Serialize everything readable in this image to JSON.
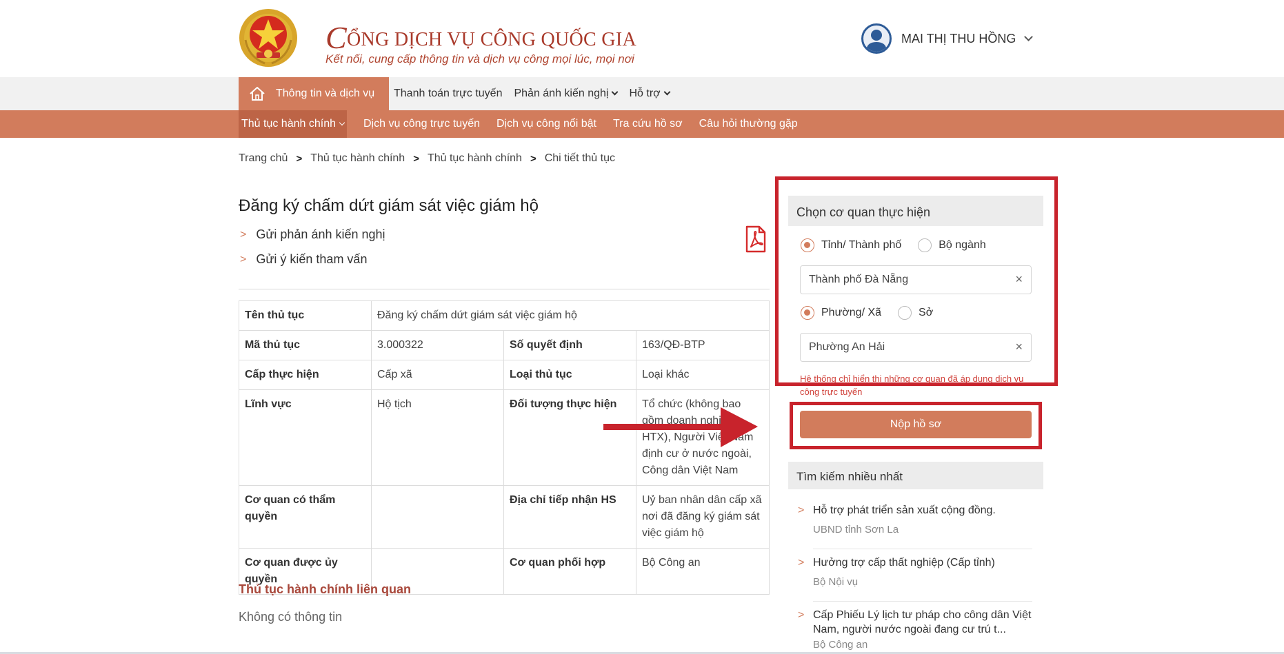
{
  "header": {
    "title_initial": "C",
    "title_rest": "ỔNG DỊCH VỤ CÔNG QUỐC GIA",
    "slogan": "Kết nối, cung cấp thông tin và dịch vụ công mọi lúc, mọi nơi",
    "user_name": "MAI THỊ THU HỒNG"
  },
  "nav_primary": {
    "home_label": "Thông tin và dịch vụ",
    "items": [
      "Thanh toán trực tuyến",
      "Phản ánh kiến nghị",
      "Hỗ trợ"
    ]
  },
  "nav_secondary": {
    "items": [
      "Thủ tục hành chính",
      "Dịch vụ công trực tuyến",
      "Dịch vụ công nổi bật",
      "Tra cứu hồ sơ",
      "Câu hỏi thường gặp"
    ]
  },
  "breadcrumb": [
    "Trang chủ",
    "Thủ tục hành chính",
    "Thủ tục hành chính",
    "Chi tiết thủ tục"
  ],
  "breadcrumb_separator": ">",
  "main": {
    "title": "Đăng ký chấm dứt giám sát việc giám hộ",
    "links": [
      "Gửi phản ánh kiến nghị",
      "Gửi ý kiến tham vấn"
    ],
    "link_chevron": ">",
    "table": {
      "ten_thu_tuc": {
        "label": "Tên thủ tục",
        "value": "Đăng ký chấm dứt giám sát việc giám hộ"
      },
      "rows": [
        {
          "l1": "Mã thủ tục",
          "v1": "3.000322",
          "l2": "Số quyết định",
          "v2": "163/QĐ-BTP"
        },
        {
          "l1": "Cấp thực hiện",
          "v1": "Cấp xã",
          "l2": "Loại thủ tục",
          "v2": "Loại khác"
        },
        {
          "l1": "Lĩnh vực",
          "v1": "Hộ tịch",
          "l2": "Đối tượng thực hiện",
          "v2": "Tổ chức (không bao gồm doanh nghiệp, HTX), Người Việt Nam định cư ở nước ngoài, Công dân Việt Nam"
        },
        {
          "l1": "Cơ quan có thẩm quyền",
          "v1": "",
          "l2": "Địa chỉ tiếp nhận HS",
          "v2": "Uỷ ban nhân dân cấp xã nơi đã đăng ký giám sát việc giám hộ"
        },
        {
          "l1": "Cơ quan được ủy quyền",
          "v1": "",
          "l2": "Cơ quan phối hợp",
          "v2": "Bộ Công an"
        }
      ]
    },
    "related_title": "Thủ tục hành chính liên quan",
    "related_empty": "Không có thông tin"
  },
  "agency_panel": {
    "title": "Chọn cơ quan thực hiện",
    "radio_group_1": {
      "option_a": "Tỉnh/ Thành phố",
      "option_b": "Bộ ngành",
      "selected": "option_a"
    },
    "select_1_value": "Thành phố Đà Nẵng",
    "radio_group_2": {
      "option_a": "Phường/ Xã",
      "option_b": "Sở",
      "selected": "option_a"
    },
    "select_2_value": "Phường An Hải",
    "clear_glyph": "×",
    "note": "Hệ thống chỉ hiển thị những cơ quan đã áp dụng dịch vụ công trực tuyến",
    "submit_label": "Nộp hồ sơ"
  },
  "popular": {
    "title": "Tìm kiếm nhiều nhất",
    "items": [
      {
        "title": "Hỗ trợ phát triển sản xuất cộng đồng.",
        "org": "UBND tỉnh Sơn La"
      },
      {
        "title": "Hưởng trợ cấp thất nghiệp (Cấp tỉnh)",
        "org": "Bộ Nội vụ"
      },
      {
        "title": "Cấp Phiếu Lý lịch tư pháp cho công dân Việt Nam, người nước ngoài đang cư trú t...",
        "org": "Bộ Công an"
      }
    ]
  },
  "colors": {
    "brand_orange": "#d27c5c",
    "brand_red": "#a93a2b",
    "annotation_red": "#c8232c",
    "note_red": "#d0413a"
  },
  "icons": [
    "national-emblem-icon",
    "user-avatar-icon",
    "chevron-down-icon",
    "home-icon",
    "pdf-icon",
    "chevron-right-icon",
    "close-icon",
    "arrow-right-icon"
  ]
}
